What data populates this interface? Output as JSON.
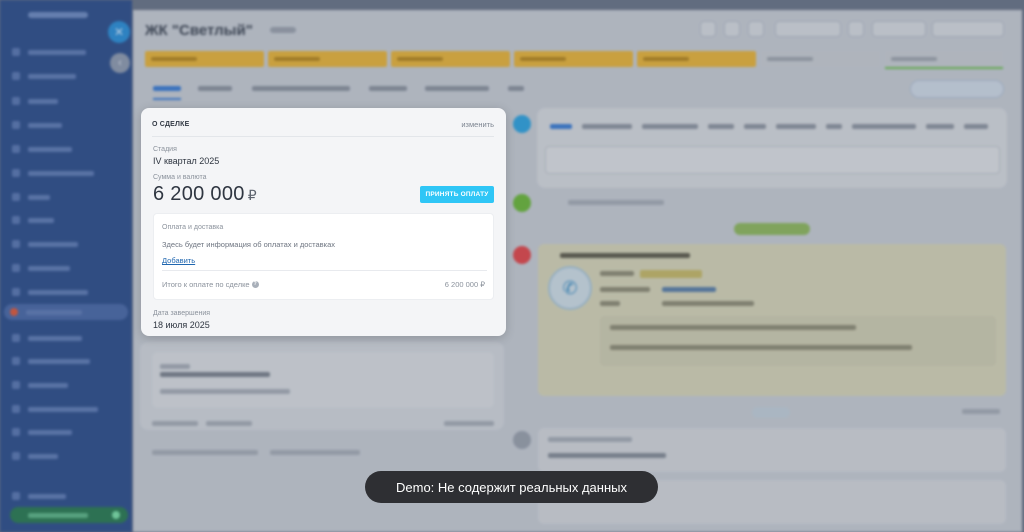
{
  "deal_card": {
    "header_title": "О СДЕЛКЕ",
    "edit_link": "изменить",
    "stage_label": "Стадия",
    "stage_value": "IV квартал 2025",
    "amount_label": "Сумма и валюта",
    "amount_value": "6 200 000",
    "amount_currency": "₽",
    "pay_button": "ПРИНЯТЬ ОПЛАТУ",
    "payment_box": {
      "title": "Оплата и доставка",
      "info": "Здесь будет информация об оплатах и доставках",
      "add_link": "Добавить",
      "total_label": "Итого к оплате по сделке",
      "total_value": "6 200 000 ₽"
    },
    "close_date_label": "Дата завершения",
    "close_date_value": "18 июля 2025"
  },
  "background": {
    "page_title": "ЖК \"Светлый\"",
    "todo_phone_icon": "phone-icon"
  },
  "toast": {
    "text": "Demo: Не содержит реальных данных"
  },
  "colors": {
    "accent_button": "#2fc6f6",
    "link": "#2067b0",
    "sidebar": "#2e4f8c",
    "stage_yellow": "#f0b72b"
  }
}
